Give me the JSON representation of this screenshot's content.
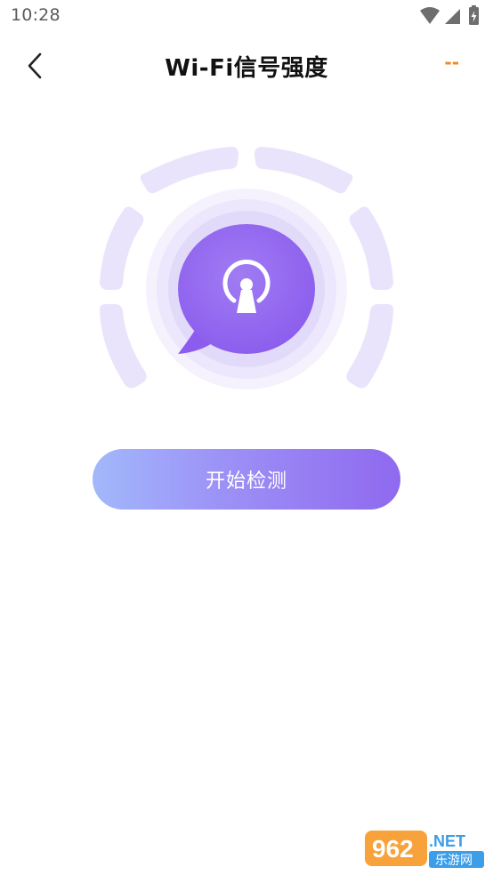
{
  "status_bar": {
    "time": "10:28"
  },
  "header": {
    "back_icon": "chevron-left-icon",
    "title": "Wi-Fi信号强度",
    "right_text": "--"
  },
  "gauge": {
    "center_icon": "wifi-antenna-icon",
    "colors": {
      "segment": "#e9e4fb",
      "ring_outer": "#f3f0fd",
      "ring_inner": "#e8e2fb",
      "bubble": "#9468ef"
    }
  },
  "start_button": {
    "label": "开始检测"
  },
  "watermark": {
    "logo_text": "962",
    "net_text": ".NET",
    "sub_text": "乐游网"
  },
  "colors": {
    "accent_orange": "#f08a1e",
    "button_gradient_start": "#a2b8fb",
    "button_gradient_end": "#8f69ef"
  }
}
